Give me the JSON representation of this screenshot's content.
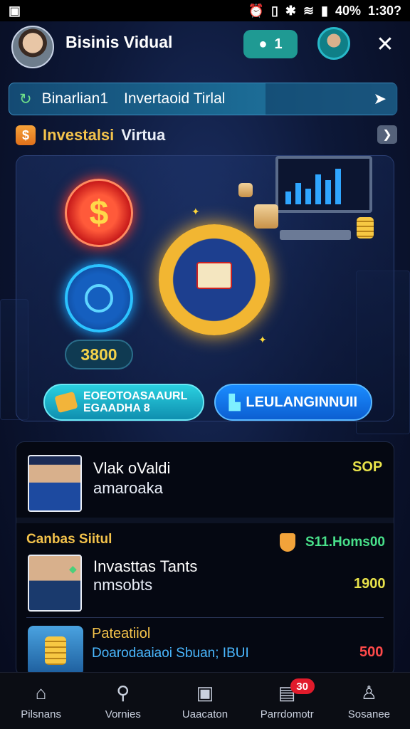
{
  "status_bar": {
    "battery": "40%",
    "time": "1:30?"
  },
  "header": {
    "title": "Bisinis Vidual",
    "message_count": "1"
  },
  "banner": {
    "text_left": "Binarlian1",
    "text_right": "Invertaoid Tirlal"
  },
  "section": {
    "title_part1": "Investalsi",
    "title_part2": "Virtua",
    "icon_label": "$"
  },
  "hero": {
    "coin_label": "$",
    "balance": "3800",
    "cta_left_line1": "EOEOTOASAAURL",
    "cta_left_line2": "EGAADHA 8",
    "cta_right": "LEULANGINNUII"
  },
  "list": {
    "item1": {
      "title": "Vlak oValdi",
      "subtitle": "amaroaka",
      "amount": "SOP",
      "amount_color": "#e8e24a"
    },
    "section_label": "Canbas Siitul",
    "section_amount": "S11.Homs00",
    "item2": {
      "title": "Invasttas Tants",
      "subtitle": "nmsobts",
      "amount": "1900",
      "amount_color": "#e8e24a"
    },
    "item3": {
      "title": "Pateatiiol",
      "subtitle": "Doarodaaiaoi Sbuan; IBUI",
      "amount": "500",
      "amount_color": "#ff4a4a"
    }
  },
  "nav": {
    "items": [
      {
        "label": "Pilsnans",
        "icon": "home-icon"
      },
      {
        "label": "Vornies",
        "icon": "search-icon"
      },
      {
        "label": "Uaacaton",
        "icon": "calendar-icon"
      },
      {
        "label": "Parrdomotr",
        "icon": "wallet-icon",
        "badge": "30"
      },
      {
        "label": "Sosanee",
        "icon": "profile-icon"
      }
    ]
  },
  "colors": {
    "accent_teal": "#1f9a93",
    "accent_gold": "#f3c24b",
    "cta_blue": "#1a8cff"
  }
}
